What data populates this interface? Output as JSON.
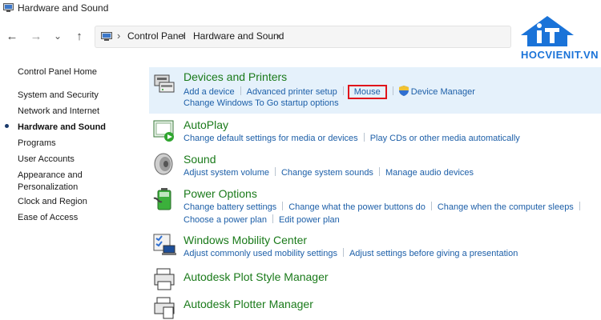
{
  "window": {
    "title": "Hardware and Sound"
  },
  "address": {
    "crumbs": [
      "Control Panel",
      "Hardware and Sound"
    ]
  },
  "logo": {
    "text": "HOCVIENIT.VN",
    "brand_color": "#1a73d8"
  },
  "sidebar": {
    "items": [
      {
        "label": "Control Panel Home"
      },
      {
        "label": "System and Security"
      },
      {
        "label": "Network and Internet"
      },
      {
        "label": "Hardware and Sound",
        "active": true
      },
      {
        "label": "Programs"
      },
      {
        "label": "User Accounts"
      },
      {
        "label": "Appearance and Personalization"
      },
      {
        "label": "Clock and Region"
      },
      {
        "label": "Ease of Access"
      }
    ]
  },
  "categories": [
    {
      "title": "Devices and Printers",
      "icon": "printer-icon",
      "links_row1": [
        "Add a device",
        "Advanced printer setup",
        "Mouse",
        "Device Manager"
      ],
      "links_row2": [
        "Change Windows To Go startup options"
      ]
    },
    {
      "title": "AutoPlay",
      "icon": "autoplay-icon",
      "links_row1": [
        "Change default settings for media or devices",
        "Play CDs or other media automatically"
      ]
    },
    {
      "title": "Sound",
      "icon": "speaker-icon",
      "links_row1": [
        "Adjust system volume",
        "Change system sounds",
        "Manage audio devices"
      ]
    },
    {
      "title": "Power Options",
      "icon": "battery-icon",
      "links_row1": [
        "Change battery settings",
        "Change what the power buttons do",
        "Change when the computer sleeps"
      ],
      "links_row2": [
        "Choose a power plan",
        "Edit power plan"
      ]
    },
    {
      "title": "Windows Mobility Center",
      "icon": "mobility-center-icon",
      "links_row1": [
        "Adjust commonly used mobility settings",
        "Adjust settings before giving a presentation"
      ]
    },
    {
      "title": "Autodesk Plot Style Manager",
      "icon": "plot-style-icon"
    },
    {
      "title": "Autodesk Plotter Manager",
      "icon": "plotter-icon"
    }
  ],
  "colors": {
    "link": "#1d5fa8",
    "category_title": "#1a7a1a",
    "highlight_box": "#e0141b",
    "selected_band": "#e5f1fb"
  }
}
